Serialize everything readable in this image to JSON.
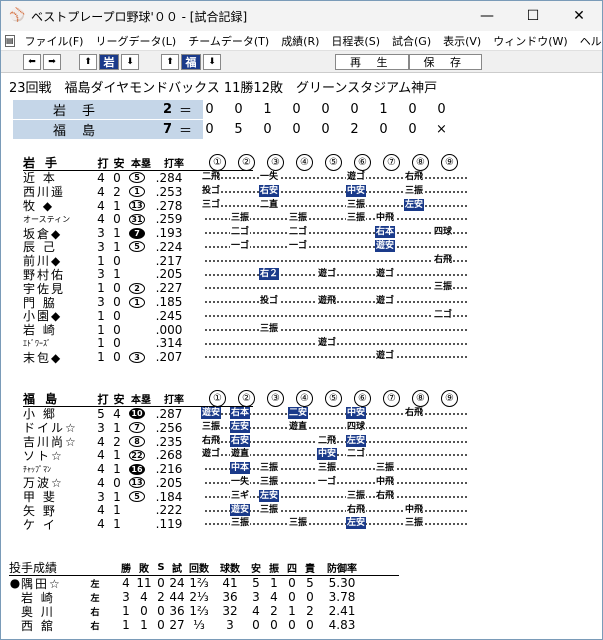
{
  "window": {
    "title": "ベストプレープロ野球'００ - [試合記録]"
  },
  "menu": [
    "ファイル(F)",
    "リーグデータ(L)",
    "チームデータ(T)",
    "成績(R)",
    "日程表(S)",
    "試合(G)",
    "表示(V)",
    "ウィンドウ(W)",
    "ヘルプ(H)"
  ],
  "toolbar": {
    "team1": "岩",
    "team2": "福",
    "replay": "再 生",
    "save": "保 存"
  },
  "game": {
    "info": "23回戦　福島ダイヤモンドバックス 11勝12敗　グリーンスタジアム神戸"
  },
  "scoreboard": [
    {
      "team": "岩手",
      "total": "2",
      "innings": [
        "0",
        "0",
        "1",
        "0",
        "0",
        "0",
        "1",
        "0",
        "0"
      ]
    },
    {
      "team": "福島",
      "total": "7",
      "innings": [
        "0",
        "5",
        "0",
        "0",
        "0",
        "2",
        "0",
        "0",
        "×"
      ]
    }
  ],
  "batting_headers": {
    "at_bat": "打",
    "hits": "安",
    "hr": "本塁",
    "avg": "打率",
    "innings": [
      "①",
      "②",
      "③",
      "④",
      "⑤",
      "⑥",
      "⑦",
      "⑧",
      "⑨"
    ]
  },
  "away_batting": {
    "team": "岩手",
    "rows": [
      {
        "name": "近 本",
        "ab": "4",
        "h": "0",
        "hr": "5",
        "hrfill": false,
        "avg": ".284",
        "res": [
          [
            "1",
            "二飛",
            false
          ],
          [
            "3",
            "一失",
            false
          ],
          [
            "6",
            "遊ゴ",
            false
          ],
          [
            "8",
            "右飛",
            false
          ]
        ]
      },
      {
        "name": "西川遥",
        "ab": "4",
        "h": "2",
        "hr": "1",
        "hrfill": false,
        "avg": ".253",
        "res": [
          [
            "1",
            "投ゴ",
            false
          ],
          [
            "3",
            "右安",
            true
          ],
          [
            "6",
            "中安",
            true
          ],
          [
            "8",
            "三振",
            false
          ]
        ]
      },
      {
        "name": "牧 ◆",
        "ab": "4",
        "h": "1",
        "hr": "13",
        "hrfill": false,
        "avg": ".278",
        "res": [
          [
            "1",
            "三ゴ",
            false
          ],
          [
            "3",
            "二直",
            false
          ],
          [
            "6",
            "三振",
            false
          ],
          [
            "8",
            "左安",
            true
          ]
        ]
      },
      {
        "name": "オースティン",
        "ab": "4",
        "h": "0",
        "hr": "31",
        "hrfill": false,
        "avg": ".259",
        "small": true,
        "res": [
          [
            "2",
            "三振",
            false
          ],
          [
            "4",
            "三振",
            false
          ],
          [
            "6",
            "三振",
            false
          ],
          [
            "7",
            "中飛",
            false
          ]
        ]
      },
      {
        "name": "坂倉◆",
        "ab": "3",
        "h": "1",
        "hr": "7",
        "hrfill": true,
        "avg": ".193",
        "res": [
          [
            "2",
            "二ゴ",
            false
          ],
          [
            "4",
            "二ゴ",
            false
          ],
          [
            "7",
            "右本",
            true
          ],
          [
            "9",
            "四球",
            false
          ]
        ]
      },
      {
        "name": "辰 己",
        "ab": "3",
        "h": "1",
        "hr": "5",
        "hrfill": false,
        "avg": ".224",
        "res": [
          [
            "2",
            "一ゴ",
            false
          ],
          [
            "4",
            "一ゴ",
            false
          ],
          [
            "7",
            "遊安",
            true
          ]
        ]
      },
      {
        "name": "前川◆",
        "ab": "1",
        "h": "0",
        "hr": "",
        "hrfill": false,
        "avg": ".217",
        "res": [
          [
            "9",
            "右飛",
            false
          ]
        ]
      },
      {
        "name": "野村佑",
        "ab": "3",
        "h": "1",
        "hr": "",
        "hrfill": false,
        "avg": ".205",
        "res": [
          [
            "3",
            "右２",
            true
          ],
          [
            "5",
            "遊ゴ",
            false
          ],
          [
            "7",
            "遊ゴ",
            false
          ]
        ]
      },
      {
        "name": "宇佐見",
        "ab": "1",
        "h": "0",
        "hr": "2",
        "hrfill": false,
        "avg": ".227",
        "res": [
          [
            "9",
            "三振",
            false
          ]
        ]
      },
      {
        "name": "門 脇",
        "ab": "3",
        "h": "0",
        "hr": "1",
        "hrfill": false,
        "avg": ".185",
        "res": [
          [
            "3",
            "投ゴ",
            false
          ],
          [
            "5",
            "遊飛",
            false
          ],
          [
            "7",
            "遊ゴ",
            false
          ]
        ]
      },
      {
        "name": "小園◆",
        "ab": "1",
        "h": "0",
        "hr": "",
        "hrfill": false,
        "avg": ".245",
        "res": [
          [
            "9",
            "二ゴ",
            false
          ]
        ]
      },
      {
        "name": "岩 崎",
        "ab": "1",
        "h": "0",
        "hr": "",
        "hrfill": false,
        "avg": ".000",
        "res": [
          [
            "3",
            "三振",
            false
          ]
        ]
      },
      {
        "name": "ｴﾄﾞﾜｰｽﾞ",
        "ab": "1",
        "h": "0",
        "hr": "",
        "hrfill": false,
        "avg": ".314",
        "small": true,
        "res": [
          [
            "5",
            "遊ゴ",
            false
          ]
        ]
      },
      {
        "name": "末包◆",
        "ab": "1",
        "h": "0",
        "hr": "3",
        "hrfill": false,
        "avg": ".207",
        "res": [
          [
            "7",
            "遊ゴ",
            false
          ]
        ]
      }
    ]
  },
  "home_batting": {
    "team": "福島",
    "rows": [
      {
        "name": "小 郷",
        "ab": "5",
        "h": "4",
        "hr": "10",
        "hrfill": true,
        "avg": ".287",
        "res": [
          [
            "1",
            "遊安",
            true
          ],
          [
            "2",
            "右本",
            true
          ],
          [
            "4",
            "二安",
            true
          ],
          [
            "6",
            "中安",
            true
          ],
          [
            "8",
            "右飛",
            false
          ]
        ]
      },
      {
        "name": "ドイル☆",
        "ab": "3",
        "h": "1",
        "hr": "7",
        "hrfill": false,
        "avg": ".256",
        "res": [
          [
            "1",
            "三振",
            false
          ],
          [
            "2",
            "左安",
            true
          ],
          [
            "4",
            "遊直",
            false
          ],
          [
            "6",
            "四球",
            false
          ]
        ]
      },
      {
        "name": "吉川尚☆",
        "ab": "4",
        "h": "2",
        "hr": "8",
        "hrfill": false,
        "avg": ".235",
        "res": [
          [
            "1",
            "右飛",
            false
          ],
          [
            "2",
            "右安",
            true
          ],
          [
            "5",
            "二飛",
            false
          ],
          [
            "6",
            "左安",
            true
          ]
        ]
      },
      {
        "name": "ソト☆",
        "ab": "4",
        "h": "1",
        "hr": "22",
        "hrfill": false,
        "avg": ".268",
        "res": [
          [
            "1",
            "遊ゴ",
            false
          ],
          [
            "2",
            "遊直",
            false
          ],
          [
            "5",
            "中安",
            true
          ],
          [
            "6",
            "二ゴ",
            false
          ]
        ]
      },
      {
        "name": "ﾁｬｯﾌﾟﾏﾝ",
        "ab": "4",
        "h": "1",
        "hr": "16",
        "hrfill": true,
        "avg": ".216",
        "small": true,
        "res": [
          [
            "2",
            "中本",
            true
          ],
          [
            "3",
            "三振",
            false
          ],
          [
            "5",
            "三振",
            false
          ],
          [
            "7",
            "三振",
            false
          ]
        ]
      },
      {
        "name": "万波☆",
        "ab": "4",
        "h": "0",
        "hr": "13",
        "hrfill": false,
        "avg": ".205",
        "res": [
          [
            "2",
            "一失",
            false
          ],
          [
            "3",
            "三振",
            false
          ],
          [
            "5",
            "一ゴ",
            false
          ],
          [
            "7",
            "中飛",
            false
          ]
        ]
      },
      {
        "name": "甲 斐",
        "ab": "3",
        "h": "1",
        "hr": "5",
        "hrfill": false,
        "avg": ".184",
        "res": [
          [
            "2",
            "三ギ",
            false
          ],
          [
            "3",
            "左安",
            true
          ],
          [
            "6",
            "三振",
            false
          ],
          [
            "7",
            "右飛",
            false
          ]
        ]
      },
      {
        "name": "矢 野",
        "ab": "4",
        "h": "1",
        "hr": "",
        "hrfill": false,
        "avg": ".222",
        "res": [
          [
            "2",
            "遊安",
            true
          ],
          [
            "3",
            "三振",
            false
          ],
          [
            "6",
            "右飛",
            false
          ],
          [
            "8",
            "中飛",
            false
          ]
        ]
      },
      {
        "name": "ケ イ",
        "ab": "4",
        "h": "1",
        "hr": "",
        "hrfill": false,
        "avg": ".119",
        "res": [
          [
            "2",
            "三振",
            false
          ],
          [
            "4",
            "三振",
            false
          ],
          [
            "6",
            "左安",
            true
          ],
          [
            "8",
            "三振",
            false
          ]
        ]
      }
    ]
  },
  "pitching": {
    "title": "投手成績",
    "headers": [
      "勝",
      "敗",
      "S",
      "試",
      "回数",
      "球数",
      "安",
      "振",
      "四",
      "責",
      "防御率"
    ],
    "rows": [
      {
        "mark": "●",
        "name": "隅田☆",
        "hand": "左",
        "w": "4",
        "l": "11",
        "s": "0",
        "g": "24",
        "ip": "1⅔",
        "pc": "41",
        "h": "5",
        "so": "1",
        "bb": "0",
        "er": "5",
        "era": "5.30"
      },
      {
        "mark": "",
        "name": "岩 崎",
        "hand": "左",
        "w": "3",
        "l": "4",
        "s": "2",
        "g": "44",
        "ip": "2⅓",
        "pc": "36",
        "h": "3",
        "so": "4",
        "bb": "0",
        "er": "0",
        "era": "3.78"
      },
      {
        "mark": "",
        "name": "奥 川",
        "hand": "右",
        "w": "1",
        "l": "0",
        "s": "0",
        "g": "36",
        "ip": "1⅔",
        "pc": "32",
        "h": "4",
        "so": "2",
        "bb": "1",
        "er": "2",
        "era": "2.41"
      },
      {
        "mark": "",
        "name": "西 舘",
        "hand": "右",
        "w": "1",
        "l": "1",
        "s": "0",
        "g": "27",
        "ip": "⅓",
        "pc": "3",
        "h": "0",
        "so": "0",
        "bb": "0",
        "er": "0",
        "era": "4.83"
      }
    ]
  }
}
